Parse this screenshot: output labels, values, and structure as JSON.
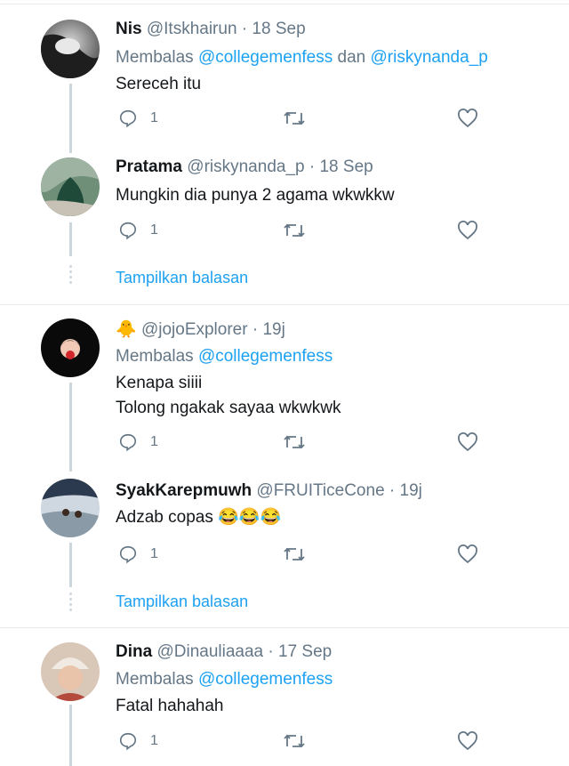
{
  "tweets": [
    {
      "display_name": "Nis",
      "handle": "@Itskhairun",
      "separator": " · ",
      "time": "18 Sep",
      "reply_prefix": "Membalas",
      "reply_to_1": "@collegemenfess",
      "reply_join": "dan",
      "reply_to_2": "@riskynanda_p",
      "text": "Sereceh itu",
      "reply_count": "1"
    },
    {
      "display_name": "Pratama",
      "handle": "@riskynanda_p",
      "separator": " · ",
      "time": "18 Sep",
      "text": "Mungkin dia punya 2 agama wkwkkw",
      "reply_count": "1"
    },
    {
      "display_name": "🐥",
      "handle": "@jojoExplorer",
      "separator": " · ",
      "time": "19j",
      "reply_prefix": "Membalas",
      "reply_to_1": "@collegemenfess",
      "text_line1": "Kenapa siiii",
      "text_line2": "Tolong ngakak sayaa wkwkwk",
      "reply_count": "1"
    },
    {
      "display_name": "SyakKarepmuwh",
      "handle": "@FRUITiceCone",
      "separator": " · ",
      "time": "19j",
      "text": "Adzab copas 😂😂😂",
      "reply_count": "1"
    },
    {
      "display_name": "Dina",
      "handle": "@Dinauliaaaa",
      "separator": " · ",
      "time": "17 Sep",
      "reply_prefix": "Membalas",
      "reply_to_1": "@collegemenfess",
      "text": "Fatal hahahah",
      "reply_count": "1"
    }
  ],
  "show_replies_label": "Tampilkan balasan",
  "colors": {
    "link": "#1da1f2",
    "muted": "#657786",
    "divider": "#e6ecf0",
    "thread_line": "#ccd6dd"
  },
  "icons": [
    "reply-icon",
    "retweet-icon",
    "like-icon",
    "avatar"
  ]
}
